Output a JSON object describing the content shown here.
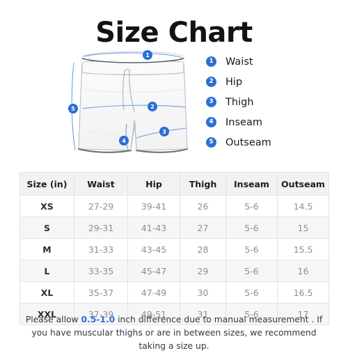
{
  "page": {
    "title": "Size Chart",
    "background_color": "#ffffff",
    "accent_color": "#2a6fd4"
  },
  "legend": {
    "items": [
      {
        "number": "1",
        "label": "Waist"
      },
      {
        "number": "2",
        "label": "Hip"
      },
      {
        "number": "3",
        "label": "Thigh"
      },
      {
        "number": "4",
        "label": "Inseam"
      },
      {
        "number": "5",
        "label": "Outseam"
      }
    ]
  },
  "diagram": {
    "name": "shorts-illustration",
    "markers": [
      {
        "number": "1",
        "measure": "Waist"
      },
      {
        "number": "2",
        "measure": "Hip"
      },
      {
        "number": "3",
        "measure": "Thigh"
      },
      {
        "number": "4",
        "measure": "Inseam"
      },
      {
        "number": "5",
        "measure": "Outseam"
      }
    ]
  },
  "table": {
    "headers": [
      "Size (in)",
      "Waist",
      "Hip",
      "Thigh",
      "Inseam",
      "Outseam"
    ],
    "rows": [
      {
        "size": "XS",
        "waist": "27-29",
        "hip": "39-41",
        "thigh": "26",
        "inseam": "5-6",
        "outseam": "14.5"
      },
      {
        "size": "S",
        "waist": "29-31",
        "hip": "41-43",
        "thigh": "27",
        "inseam": "5-6",
        "outseam": "15"
      },
      {
        "size": "M",
        "waist": "31-33",
        "hip": "43-45",
        "thigh": "28",
        "inseam": "5-6",
        "outseam": "15.5"
      },
      {
        "size": "L",
        "waist": "33-35",
        "hip": "45-47",
        "thigh": "29",
        "inseam": "5-6",
        "outseam": "16"
      },
      {
        "size": "XL",
        "waist": "35-37",
        "hip": "47-49",
        "thigh": "30",
        "inseam": "5-6",
        "outseam": "16.5"
      },
      {
        "size": "XXL",
        "waist": "37-39",
        "hip": "49-51",
        "thigh": "31",
        "inseam": "5-6",
        "outseam": "17"
      }
    ]
  },
  "note": {
    "before": "Please allow ",
    "highlight": "0.5-1.0",
    "after": " inch difference due to manual measurement . If you have muscular thighs or are in between sizes, we recommend taking a size up."
  }
}
